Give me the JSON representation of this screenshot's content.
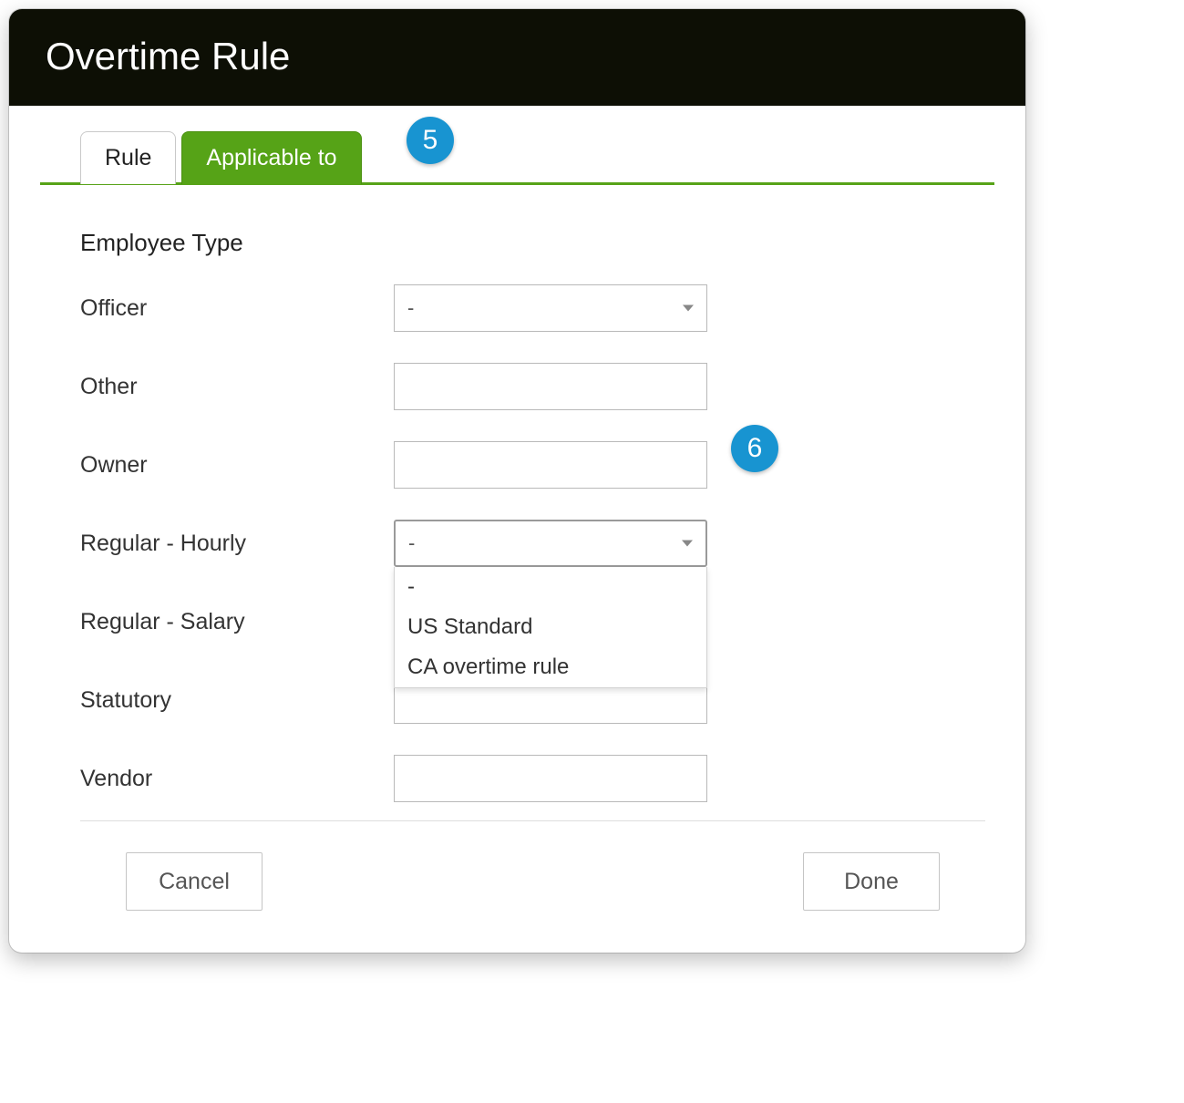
{
  "dialog": {
    "title": "Overtime Rule"
  },
  "tabs": {
    "rule": "Rule",
    "applicable_to": "Applicable to"
  },
  "callouts": {
    "five": "5",
    "six": "6"
  },
  "section": {
    "heading": "Employee Type"
  },
  "rows": {
    "officer": {
      "label": "Officer",
      "value": "-"
    },
    "other": {
      "label": "Other",
      "value": ""
    },
    "owner": {
      "label": "Owner",
      "value": ""
    },
    "regular_hourly": {
      "label": "Regular - Hourly",
      "value": "-"
    },
    "regular_salary": {
      "label": "Regular - Salary",
      "value": ""
    },
    "statutory": {
      "label": "Statutory",
      "value": ""
    },
    "vendor": {
      "label": "Vendor",
      "value": ""
    }
  },
  "dropdown": {
    "opt_blank": "-",
    "opt_us": "US Standard",
    "opt_ca": "CA overtime rule"
  },
  "footer": {
    "cancel": "Cancel",
    "done": "Done"
  }
}
